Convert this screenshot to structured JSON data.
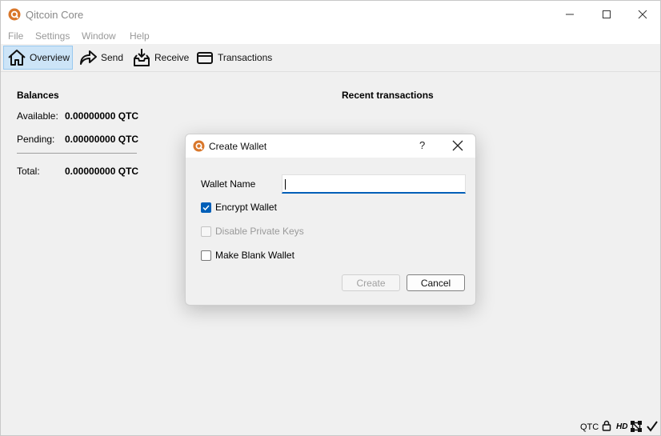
{
  "window": {
    "title": "Qitcoin Core",
    "controls": {
      "minimize": "minimize-icon",
      "maximize": "maximize-icon",
      "close": "close-icon"
    }
  },
  "menu": [
    "File",
    "Settings",
    "Window",
    "Help"
  ],
  "toolbar": {
    "overview": "Overview",
    "send": "Send",
    "receive": "Receive",
    "transactions": "Transactions",
    "active": "overview"
  },
  "balances": {
    "title": "Balances",
    "available_label": "Available:",
    "available_value": "0.00000000 QTC",
    "pending_label": "Pending:",
    "pending_value": "0.00000000 QTC",
    "total_label": "Total:",
    "total_value": "0.00000000 QTC"
  },
  "recent": {
    "title": "Recent transactions"
  },
  "statusbar": {
    "unit": "QTC",
    "hd": "HD"
  },
  "dialog": {
    "title": "Create Wallet",
    "help": "?",
    "wallet_name_label": "Wallet Name",
    "wallet_name_value": "",
    "encrypt_label": "Encrypt Wallet",
    "encrypt_checked": true,
    "disable_keys_label": "Disable Private Keys",
    "disable_keys_checked": false,
    "disable_keys_enabled": false,
    "blank_label": "Make Blank Wallet",
    "blank_checked": false,
    "create_label": "Create",
    "create_enabled": false,
    "cancel_label": "Cancel"
  },
  "colors": {
    "accent": "#005fb8",
    "logo": "#d9772b",
    "toolbar_active": "#cce4f7"
  }
}
